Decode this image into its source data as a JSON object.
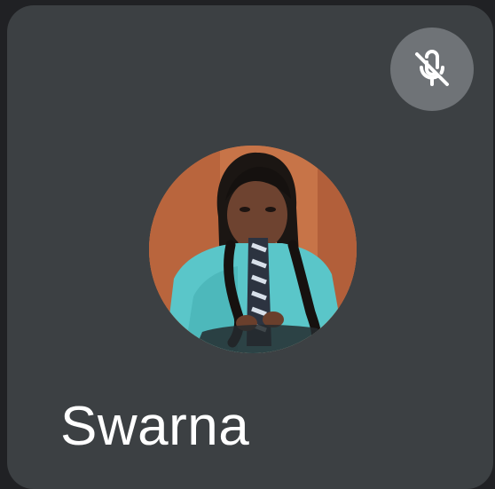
{
  "participant": {
    "name": "Swarna",
    "avatar_icon": "participant-photo",
    "mic_state": "muted",
    "mic_icon": "mic-off-icon"
  },
  "colors": {
    "page_background": "#202124",
    "tile_background": "#3c4043",
    "mic_badge_background": "#6f7377",
    "name_text": "#ffffff"
  }
}
